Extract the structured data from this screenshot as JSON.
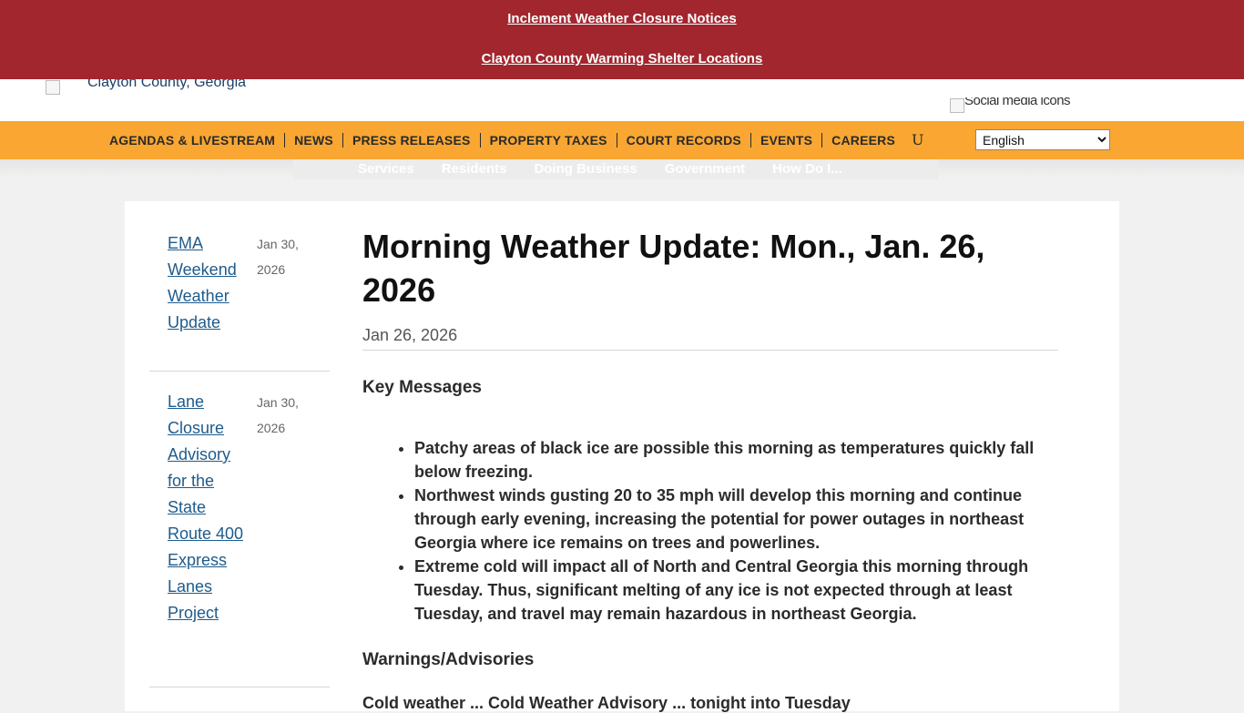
{
  "alerts": [
    "Inclement Weather Closure Notices",
    "Clayton County Warming Shelter Locations"
  ],
  "header": {
    "logo_alt": "Clayton County, Georgia",
    "social_alt": "Social media icons"
  },
  "nav": {
    "items": [
      {
        "label": "AGENDAS & LIVESTREAM",
        "icon": "broken-glyph"
      },
      {
        "label": "NEWS"
      },
      {
        "label": "PRESS RELEASES"
      },
      {
        "label": "PROPERTY TAXES"
      },
      {
        "label": "COURT RECORDS"
      },
      {
        "label": "EVENTS"
      },
      {
        "label": "CAREERS"
      }
    ],
    "search_glyph": "U",
    "language": "English"
  },
  "mega_menu": [
    "Services",
    "Residents",
    "Doing Business",
    "Government",
    "How Do I..."
  ],
  "sidebar": [
    {
      "title": "EMA Weekend Weather Update",
      "date": "Jan 30, 2026"
    },
    {
      "title": "Lane Closure Advisory for the State Route 400 Express Lanes Project",
      "date": "Jan 30, 2026"
    }
  ],
  "article": {
    "title": "Morning Weather Update: Mon., Jan. 26, 2026",
    "date": "Jan 26, 2026",
    "key_messages_heading": "Key Messages",
    "key_messages": [
      "Patchy areas of black ice are possible this morning as temperatures quickly fall below freezing.",
      "Northwest winds gusting 20 to 35 mph will develop this morning and continue through early evening, increasing the potential for power outages in northeast Georgia where ice remains on trees and powerlines.",
      "Extreme cold will impact all of North and Central Georgia this morning through Tuesday. Thus, significant melting of any ice is not expected through at least Tuesday, and travel may remain hazardous in northeast Georgia."
    ],
    "warnings_heading": "Warnings/Advisories",
    "warnings_text": "Cold weather ... Cold Weather Advisory ... tonight into Tuesday"
  }
}
